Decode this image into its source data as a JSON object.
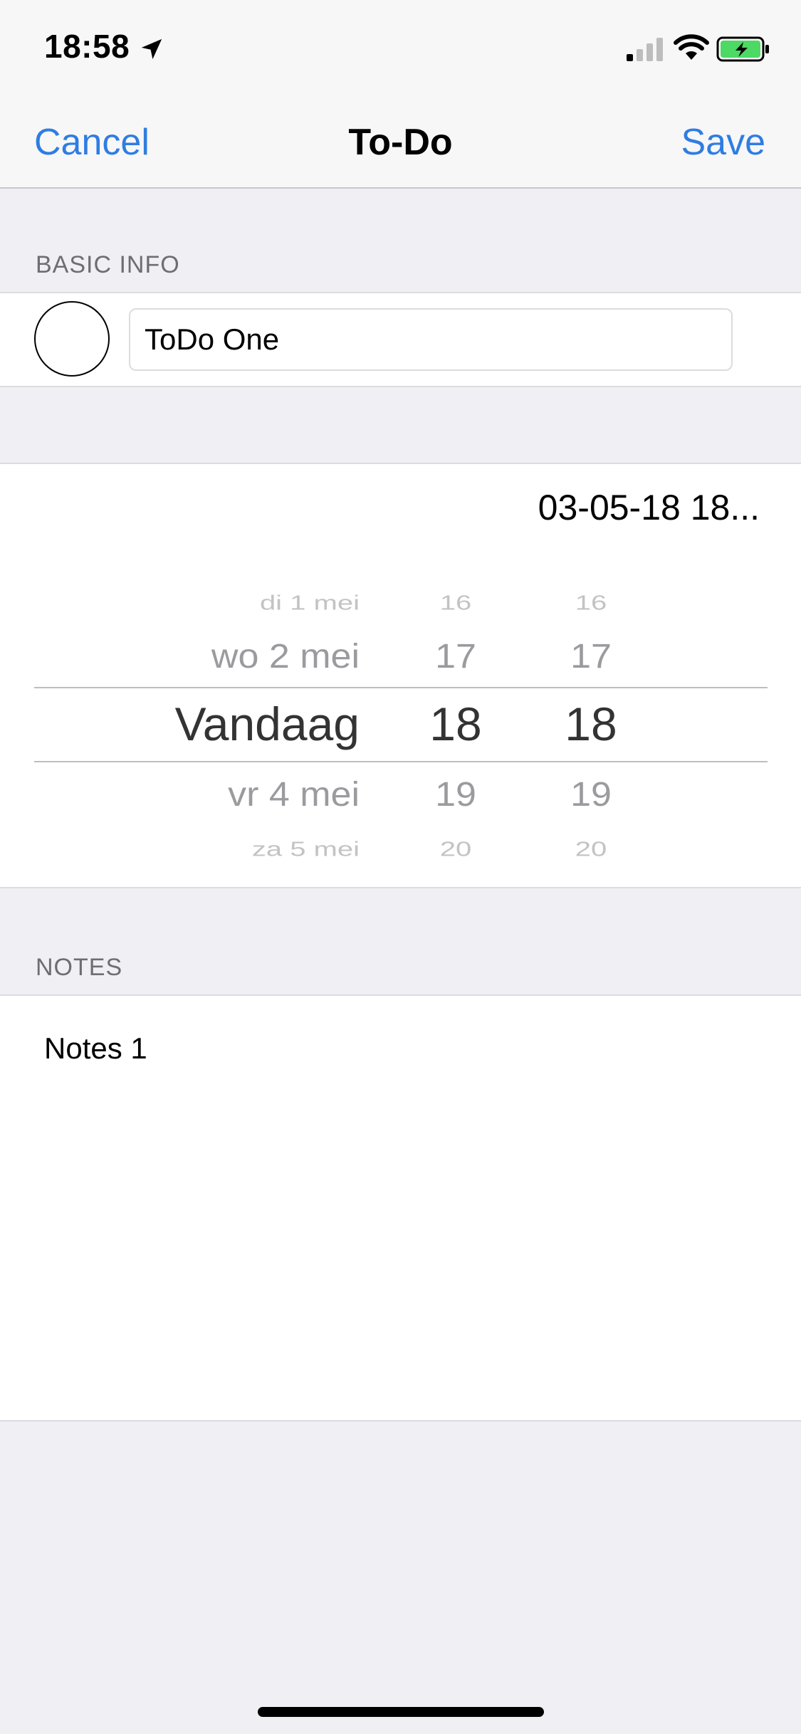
{
  "status_bar": {
    "time": "18:58"
  },
  "nav": {
    "cancel_label": "Cancel",
    "title": "To-Do",
    "save_label": "Save",
    "accent_color": "#2f7de1"
  },
  "basic_info": {
    "header": "BASIC INFO",
    "title_value": "ToDo One"
  },
  "date_time": {
    "display": "03-05-18 18...",
    "picker": {
      "day_column": {
        "items": [
          "di 1 mei",
          "wo 2 mei",
          "Vandaag",
          "vr 4 mei",
          "za 5 mei"
        ],
        "selected": "Vandaag"
      },
      "hour_column": {
        "items": [
          "16",
          "17",
          "18",
          "19",
          "20"
        ],
        "selected": "18"
      },
      "minute_column": {
        "items": [
          "16",
          "17",
          "18",
          "19",
          "20"
        ],
        "selected": "18"
      }
    }
  },
  "notes": {
    "header": "NOTES",
    "value": "Notes 1"
  }
}
